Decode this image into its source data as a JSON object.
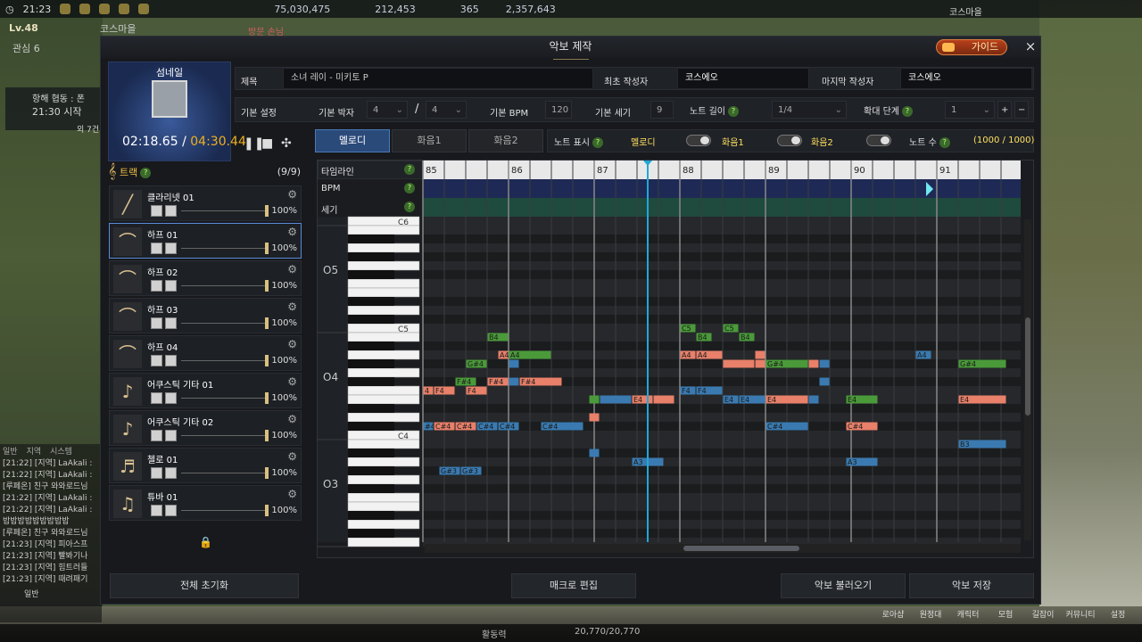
{
  "game_hud": {
    "clock": "21:23",
    "level": "Lv.48",
    "town": "코스마을",
    "likes": "관심 6",
    "visitor_label": "방문 손님",
    "event_text": "항해 협동 : 폰",
    "event_time": "21:30 시작",
    "event_extra": "외 7건",
    "currency_1": "75,030,475",
    "currency_2": "212,453",
    "currency_3": "365",
    "currency_4": "2,357,643",
    "map_town": "코스마을",
    "activity_label": "활동력",
    "activity_value": "20,770/20,770",
    "chat_tabs": [
      "일반",
      "지역",
      "시스템"
    ],
    "chat_lines": [
      "[21:22] [지역] LaAkali :",
      "[21:22] [지역] LaAkali :",
      "[루페온] 친구 와와로드님",
      "[21:22] [지역] LaAkali :",
      "[21:22] [지역] LaAkali :",
      "밥밥밥밥밥밥밥밥밥",
      "[루페온] 친구 와와로드님",
      "[21:23] [지역] 피아스프",
      "[21:23] [지역] 빨봐기나",
      "[21:23] [지역] 힘트러들",
      "[21:23] [지역] 때려패기"
    ],
    "chat_mode": "일반",
    "right_menu": [
      "로아샵",
      "원정대",
      "캐릭터",
      "모험",
      "길잡이",
      "커뮤니티",
      "설정"
    ]
  },
  "window": {
    "title": "악보 제작",
    "guide_label": "가이드",
    "close_label": "×",
    "thumbnail_label": "섬네일"
  },
  "meta": {
    "title_label": "제목",
    "title_value": "소녀 레이 - 미키토 P",
    "first_author_label": "최초 작성자",
    "first_author_value": "코스에오",
    "last_author_label": "마지막 작성자",
    "last_author_value": "코스에오"
  },
  "settings": {
    "section_label": "기본 설정",
    "beat_label": "기본 박자",
    "beat_num": "4",
    "beat_slash": "/",
    "beat_den": "4",
    "bpm_label": "기본 BPM",
    "bpm_value": "120",
    "velocity_label": "기본 세기",
    "velocity_value": "9",
    "note_len_label": "노트 길이",
    "note_len_value": "1/4",
    "zoom_label": "확대 단계",
    "zoom_value": "1",
    "zoom_plus": "+",
    "zoom_minus": "−"
  },
  "playback": {
    "current": "02:18.65",
    "separator": " / ",
    "total": "04:30.44"
  },
  "tabs": [
    "멜로디",
    "화음1",
    "화음2"
  ],
  "note_display": {
    "label": "노트 표시",
    "toggles": [
      "멜로디",
      "화음1",
      "화음2"
    ],
    "count_label": "노트 수",
    "count_value": "(1000 / 1000)"
  },
  "tracks": {
    "header": "트랙",
    "count": "(9/9)",
    "items": [
      {
        "name": "클라리넷 01",
        "icon": "clarinet-icon",
        "volume": "100%"
      },
      {
        "name": "하프 01",
        "icon": "harp-icon",
        "volume": "100%"
      },
      {
        "name": "하프 02",
        "icon": "harp-icon",
        "volume": "100%"
      },
      {
        "name": "하프 03",
        "icon": "harp-icon",
        "volume": "100%"
      },
      {
        "name": "하프 04",
        "icon": "harp-icon",
        "volume": "100%"
      },
      {
        "name": "어쿠스틱 기타 01",
        "icon": "guitar-icon",
        "volume": "100%"
      },
      {
        "name": "어쿠스틱 기타 02",
        "icon": "guitar-icon",
        "volume": "100%"
      },
      {
        "name": "첼로 01",
        "icon": "cello-icon",
        "volume": "100%"
      },
      {
        "name": "튜바 01",
        "icon": "tuba-icon",
        "volume": "100%"
      }
    ]
  },
  "roll": {
    "timeline_label": "타임라인",
    "bpm_label": "BPM",
    "velocity_label": "세기",
    "measures": [
      "85",
      "86",
      "87",
      "88",
      "89",
      "90",
      "91"
    ],
    "octaves": [
      "O5",
      "O4",
      "O3"
    ],
    "key_labels": [
      "C6",
      "C5",
      "C4"
    ],
    "colors": {
      "melody": "#e8806a",
      "chord1": "#4a9a3a",
      "chord2": "#3a7ab0",
      "playhead": "#20a8d8"
    },
    "notes": [
      {
        "label": "B4",
        "color": "chord1",
        "beat": 3.0,
        "pitch": 71,
        "len": 1
      },
      {
        "label": "A4",
        "color": "melody",
        "beat": 3.5,
        "pitch": 69,
        "len": 0.5
      },
      {
        "label": "",
        "color": "chord2",
        "beat": 4.0,
        "pitch": 68,
        "len": 0.5
      },
      {
        "label": "A4",
        "color": "chord1",
        "beat": 4.0,
        "pitch": 69,
        "len": 2
      },
      {
        "label": "G#4",
        "color": "chord1",
        "beat": 2.0,
        "pitch": 68,
        "len": 1
      },
      {
        "label": "F#4",
        "color": "chord1",
        "beat": 1.5,
        "pitch": 66,
        "len": 1
      },
      {
        "label": "F#4",
        "color": "melody",
        "beat": 3.0,
        "pitch": 66,
        "len": 1
      },
      {
        "label": "",
        "color": "chord2",
        "beat": 4.0,
        "pitch": 66,
        "len": 0.5
      },
      {
        "label": "F#4",
        "color": "melody",
        "beat": 4.5,
        "pitch": 66,
        "len": 2
      },
      {
        "label": "4",
        "color": "melody",
        "beat": 0.0,
        "pitch": 65,
        "len": 0.5
      },
      {
        "label": "F4",
        "color": "melody",
        "beat": 0.5,
        "pitch": 65,
        "len": 1
      },
      {
        "label": "F4",
        "color": "melody",
        "beat": 2.0,
        "pitch": 65,
        "len": 1
      },
      {
        "label": "#4",
        "color": "chord2",
        "beat": 0.0,
        "pitch": 61,
        "len": 0.5
      },
      {
        "label": "C#4",
        "color": "melody",
        "beat": 0.5,
        "pitch": 61,
        "len": 1
      },
      {
        "label": "C#4",
        "color": "melody",
        "beat": 1.5,
        "pitch": 61,
        "len": 1
      },
      {
        "label": "C#4",
        "color": "chord2",
        "beat": 2.5,
        "pitch": 61,
        "len": 1
      },
      {
        "label": "C#4",
        "color": "chord2",
        "beat": 3.5,
        "pitch": 61,
        "len": 1
      },
      {
        "label": "C#4",
        "color": "chord2",
        "beat": 5.5,
        "pitch": 61,
        "len": 2
      },
      {
        "label": "G#3",
        "color": "chord2",
        "beat": 0.75,
        "pitch": 56,
        "len": 1
      },
      {
        "label": "G#3",
        "color": "chord2",
        "beat": 1.75,
        "pitch": 56,
        "len": 1
      },
      {
        "label": "",
        "color": "chord1",
        "beat": 7.75,
        "pitch": 64,
        "len": 0.5
      },
      {
        "label": "",
        "color": "melody",
        "beat": 7.75,
        "pitch": 62,
        "len": 0.5
      },
      {
        "label": "",
        "color": "chord2",
        "beat": 8.25,
        "pitch": 64,
        "len": 1.5
      },
      {
        "label": "E4",
        "color": "melody",
        "beat": 9.75,
        "pitch": 64,
        "len": 1
      },
      {
        "label": "",
        "color": "melody",
        "beat": 10.75,
        "pitch": 64,
        "len": 1
      },
      {
        "label": "",
        "color": "chord2",
        "beat": 7.75,
        "pitch": 58,
        "len": 0.5
      },
      {
        "label": "A3",
        "color": "chord2",
        "beat": 9.75,
        "pitch": 57,
        "len": 1.5
      },
      {
        "label": "C5",
        "color": "chord1",
        "beat": 12.0,
        "pitch": 72,
        "len": 0.75
      },
      {
        "label": "C5",
        "color": "chord1",
        "beat": 14.0,
        "pitch": 72,
        "len": 0.75
      },
      {
        "label": "B4",
        "color": "chord1",
        "beat": 12.75,
        "pitch": 71,
        "len": 0.75
      },
      {
        "label": "B4",
        "color": "chord1",
        "beat": 14.75,
        "pitch": 71,
        "len": 0.75
      },
      {
        "label": "A4",
        "color": "melody",
        "beat": 12.0,
        "pitch": 69,
        "len": 0.75
      },
      {
        "label": "A4",
        "color": "melody",
        "beat": 12.75,
        "pitch": 69,
        "len": 1.25
      },
      {
        "label": "",
        "color": "melody",
        "beat": 15.5,
        "pitch": 69,
        "len": 0.5
      },
      {
        "label": "",
        "color": "melody",
        "beat": 14.0,
        "pitch": 68,
        "len": 1.5
      },
      {
        "label": "",
        "color": "melody",
        "beat": 15.5,
        "pitch": 68,
        "len": 0.5
      },
      {
        "label": "G#4",
        "color": "chord1",
        "beat": 16.0,
        "pitch": 68,
        "len": 2
      },
      {
        "label": "",
        "color": "melody",
        "beat": 18.0,
        "pitch": 68,
        "len": 0.5
      },
      {
        "label": "F4",
        "color": "chord2",
        "beat": 12.0,
        "pitch": 65,
        "len": 0.75
      },
      {
        "label": "F4",
        "color": "chord2",
        "beat": 12.75,
        "pitch": 65,
        "len": 1.25
      },
      {
        "label": "E4",
        "color": "chord2",
        "beat": 14.0,
        "pitch": 64,
        "len": 0.75
      },
      {
        "label": "E4",
        "color": "chord2",
        "beat": 14.75,
        "pitch": 64,
        "len": 1.25
      },
      {
        "label": "E4",
        "color": "melody",
        "beat": 16.0,
        "pitch": 64,
        "len": 2
      },
      {
        "label": "",
        "color": "chord2",
        "beat": 18.0,
        "pitch": 64,
        "len": 0.5
      },
      {
        "label": "C#4",
        "color": "chord2",
        "beat": 16.0,
        "pitch": 61,
        "len": 2
      },
      {
        "label": "",
        "color": "chord2",
        "beat": 18.5,
        "pitch": 68,
        "len": 0.5
      },
      {
        "label": "",
        "color": "chord2",
        "beat": 18.5,
        "pitch": 66,
        "len": 0.5
      },
      {
        "label": "E4",
        "color": "chord1",
        "beat": 19.75,
        "pitch": 64,
        "len": 1.5
      },
      {
        "label": "C#4",
        "color": "melody",
        "beat": 19.75,
        "pitch": 61,
        "len": 1.5
      },
      {
        "label": "A3",
        "color": "chord2",
        "beat": 19.75,
        "pitch": 57,
        "len": 1.5
      },
      {
        "label": "A4",
        "color": "chord2",
        "beat": 23.0,
        "pitch": 69,
        "len": 0.75
      },
      {
        "label": "G#4",
        "color": "chord1",
        "beat": 25.0,
        "pitch": 68,
        "len": 2.25
      },
      {
        "label": "E4",
        "color": "melody",
        "beat": 25.0,
        "pitch": 64,
        "len": 2.25
      },
      {
        "label": "B3",
        "color": "chord2",
        "beat": 25.0,
        "pitch": 59,
        "len": 2.25
      }
    ],
    "playhead_beat": 10.5
  },
  "bottom_buttons": [
    "전체 초기화",
    "매크로 편집",
    "악보 불러오기",
    "악보 저장"
  ]
}
